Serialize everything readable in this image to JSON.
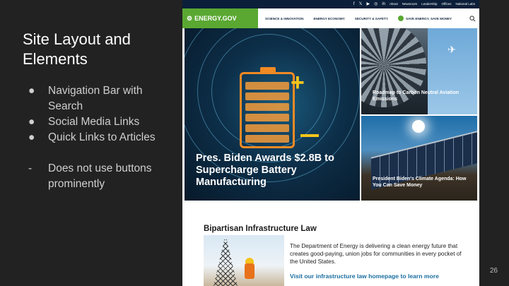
{
  "slide": {
    "title": "Site Layout and Elements",
    "bullets": [
      {
        "mark": "●",
        "text": "Navigation Bar with Search"
      },
      {
        "mark": "●",
        "text": "Social Media Links"
      },
      {
        "mark": "●",
        "text": "Quick Links to Articles"
      }
    ],
    "note": {
      "mark": "-",
      "text": "Does not use buttons prominently"
    },
    "page_number": "26"
  },
  "site": {
    "social_icons": [
      "f",
      "𝕏",
      "▶",
      "◎",
      "in"
    ],
    "top_links": [
      "About",
      "Newsroom",
      "Leadership",
      "Offices",
      "National Labs"
    ],
    "logo": "ENERGY.GOV",
    "nav": [
      "SCIENCE & INNOVATION",
      "ENERGY ECONOMY",
      "SECURITY & SAFETY"
    ],
    "save_energy": "SAVE ENERGY, SAVE MONEY",
    "hero_title": "Pres. Biden Awards $2.8B to Supercharge Battery Manufacturing",
    "tile1_title": "Roadmap to Carbon Neutral Aviation Emissions",
    "tile2_title": "President Biden's Climate Agenda: How You Can Save Money",
    "section_title": "Bipartisan Infrastructure Law",
    "section_text": "The Department of Energy is delivering a clean energy future that creates good-paying, union jobs for communities in every pocket of the United States.",
    "section_link": "Visit our infrastructure law homepage to learn more"
  },
  "colors": {
    "brand_green": "#5aa832",
    "top_bar": "#0b1f3a",
    "link_blue": "#1a6ea0",
    "slide_bg": "#222222"
  }
}
